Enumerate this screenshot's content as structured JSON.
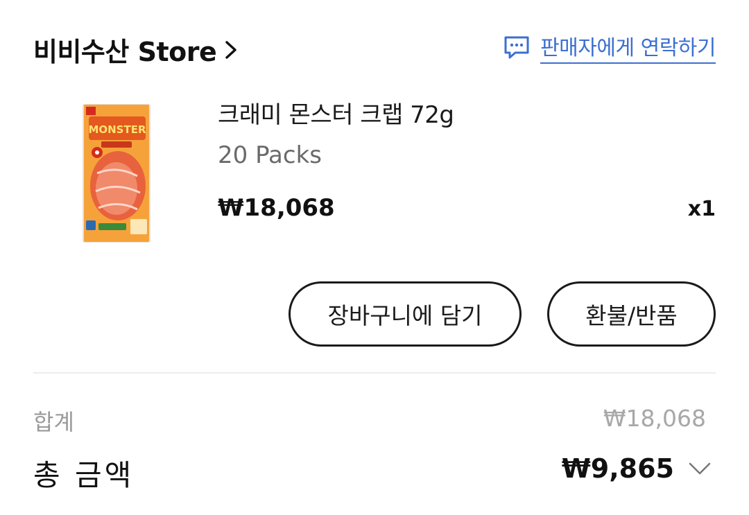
{
  "store": {
    "name": "비비수산 Store",
    "contact_label": "판매자에게 연락하기"
  },
  "product": {
    "name": "크래미 몬스터 크랩 72g",
    "option": "20 Packs",
    "price": "₩18,068",
    "quantity": "x1",
    "thumbnail_text": "MONSTER"
  },
  "actions": {
    "add_to_cart": "장바구니에 담기",
    "refund_return": "환불/반품"
  },
  "summary": {
    "subtotal_label": "합계",
    "subtotal_value": "₩18,068",
    "total_label": "총 금액",
    "total_value": "₩9,865"
  },
  "colors": {
    "link": "#3b6fd1",
    "text": "#1a1a1a",
    "muted": "#9a9a9a"
  }
}
